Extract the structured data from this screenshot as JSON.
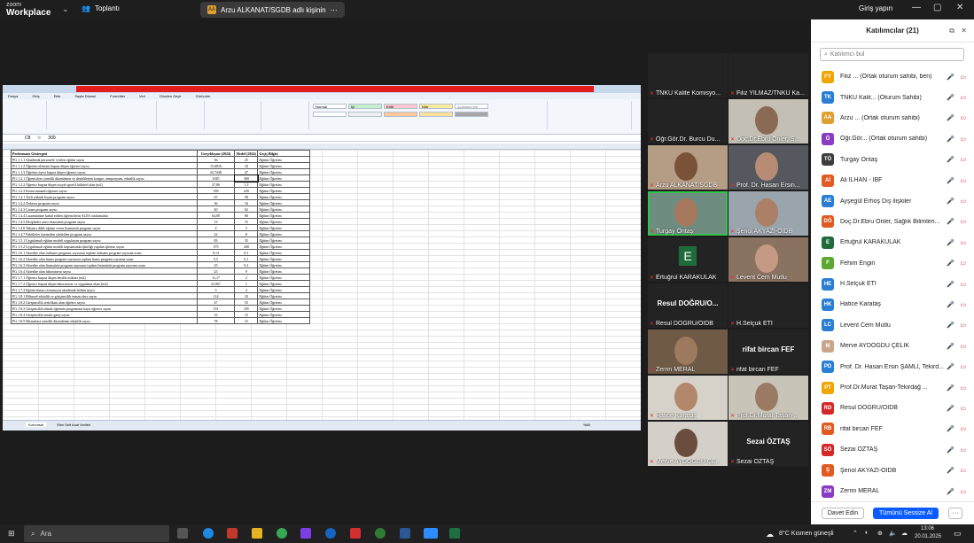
{
  "app": {
    "brand_small": "zoom",
    "brand": "Workplace",
    "meeting": "Toplantı",
    "sharing": "Arzu ALKANAT/SGDB adlı kişinin",
    "signin": "Giriş yapın"
  },
  "excel": {
    "tabs": [
      "Dosya",
      "Giriş",
      "Ekle",
      "Sayfa Düzeni",
      "Formüller",
      "Veri",
      "Gözden Geçir",
      "Görünüm"
    ],
    "styles": [
      "Normal",
      "İyi",
      "Kötü",
      "Nötr",
      "Açıklama Me..."
    ],
    "name_box": "C8",
    "formula": "300",
    "headers": [
      "Performans Göstergesi",
      "Gerçekleşme (2024)",
      "Hedef (2024)",
      "Geçiş Bilgisi"
    ],
    "rows": [
      [
        "PG 1.1.1 Akademik personele verilen eğitim sayısı",
        "36",
        "25",
        "Eğitim Öğretim"
      ],
      [
        "PG 1.1.2 Öğretim elemanı başına düşen öğrenci sayısı",
        "15,6816",
        "18",
        "Eğitim Öğretim"
      ],
      [
        "PG 1.1.3 Öğretim üyesi başına düşen öğrenci sayısı",
        "25,7438",
        "47",
        "Eğitim Öğretim"
      ],
      [
        "PG 1.2.1 Öğrencilere yönelik düzenlenen ve desteklenen kongre, sempozyum, etkinlik sayısı",
        "1045",
        "300",
        "Eğitim Öğretim"
      ],
      [
        "PG 1.2.2 Öğrenci başına düşen sosyal sportif kültürel alan (m2)",
        "27,86",
        "1,3",
        "Eğitim Öğretim"
      ],
      [
        "PG 1.2.3 Kısmi zamanlı öğrenci sayısı",
        "339",
        "220",
        "Eğitim Öğretim"
      ],
      [
        "PG 1.4.1 Tezli yüksek lisans program sayısı",
        "67",
        "58",
        "Eğitim Öğretim"
      ],
      [
        "PG 1.4.2 Doktora program sayısı",
        "36",
        "34",
        "Eğitim Öğretim"
      ],
      [
        "PG 1.4.3 Lisans program sayısı",
        "40",
        "62",
        "Eğitim Öğretim"
      ],
      [
        "PG 1.4.4 Lisansüstüne kabul edilen öğrencilerin ALES ortalamaları",
        "64,08",
        "80",
        "Eğitim Öğretim"
      ],
      [
        "PG 1.4.5 Disiplinler arası lisansüstü program sayısı",
        "13",
        "15",
        "Eğitim Öğretim"
      ],
      [
        "PG 1.4.6 Yabancı dilde eğitim veren lisansüstü program sayısı",
        "4",
        "3",
        "Eğitim Öğretim"
      ],
      [
        "PG 1.4.7 Fakülteler üzerinden yürütülen program sayısı",
        "22",
        "8",
        "Eğitim Öğretim"
      ],
      [
        "PG 1.5.1 Uygulamalı eğitim modeli uygulayan program sayısı",
        "83",
        "35",
        "Eğitim Öğretim"
      ],
      [
        "PG 1.5.2 Uygulamalı eğitim modeli kapsamında işbirliği yapılan işletme sayısı",
        "375",
        "200",
        "Eğitim Öğretim"
      ],
      [
        "PG 1.6.1 Akredite olan önlisans programı sayısının toplam önlisans program sayısına oranı",
        "0,13",
        "0,1",
        "Eğitim Öğretim"
      ],
      [
        "PG 1.6.2 Akredite olan lisans program sayısının toplam lisans program sayısına oranı",
        "5,5",
        "0,1",
        "Eğitim Öğretim"
      ],
      [
        "PG 1.6.3 Akredite olan lisansüstü program sayısının toplam lisansüstü program sayısına oranı",
        "25",
        "0,1",
        "Eğitim Öğretim"
      ],
      [
        "PG 1.6.4 Akredite olan laboratuvar sayısı",
        "25",
        "9",
        "Eğitim Öğretim"
      ],
      [
        "PG 1.7.1 Öğrenci başına düşen derslik miktarı (m2)",
        "11,17",
        "2",
        "Eğitim Öğretim"
      ],
      [
        "PG 1.7.2 Öğrenci başına düşen laboratuvar ve uygulama alanı (m2)",
        "23,067",
        "1",
        "Eğitim Öğretim"
      ],
      [
        "PG 1.7.3 Eğitim binası otomasyon akademik bölüm sayısı",
        "3",
        "4",
        "Eğitim Öğretim"
      ],
      [
        "PG 1.8.1 Bilimsel etkinlik ve girişimcilik teması ders sayısı",
        "114",
        "18",
        "Eğitim Öğretim"
      ],
      [
        "PG 1.8.2 Girişimcilik sertifikası alan öğrenci sayısı",
        "47",
        "55",
        "Eğitim Öğretim"
      ],
      [
        "PG 1.8.3 Girişimcilik teknik öğrenim programına kayıt öğrenci sayısı",
        "191",
        "105",
        "Eğitim Öğretim"
      ],
      [
        "PG 1.8.4 Girişimcilik temalı garaj sayısı",
        "15",
        "15",
        "Eğitim Öğretim"
      ],
      [
        "PG 1.8.5 Mezunlara yönelik düzenlenen etkinlik sayısı",
        "78",
        "15",
        "Eğitim Öğretim"
      ]
    ],
    "sheet_tab": "Kurumsal",
    "sheet_tab2": "Stim Seit Anal Verileri",
    "zoom": "%80"
  },
  "tiles": [
    {
      "name": "TNKÜ Kalite Komisyo...",
      "kind": "blank"
    },
    {
      "name": "Filiz YILMAZ/TNKÜ Ka...",
      "kind": "blank"
    },
    {
      "name": "Öğr.Gör.Dr. Burcu Du...",
      "kind": "blank"
    },
    {
      "name": "Doç.Dr.Ebru Önler, S...",
      "kind": "video",
      "bg": "#c4bfb5",
      "face": "#8a6a52"
    },
    {
      "name": "Arzu ALKANAT/SGDB",
      "kind": "video",
      "bg": "#b59c85",
      "face": "#7a5238"
    },
    {
      "name": "Prof. Dr. Hasan Ersin...",
      "kind": "video",
      "bg": "#55595f",
      "face": "#b88c74"
    },
    {
      "name": "Turgay Öntaş",
      "kind": "video",
      "bg": "#6f8c80",
      "face": "#a6785e",
      "active": true
    },
    {
      "name": "Şenol AKYAZI-OİDB",
      "kind": "video",
      "bg": "#9aa4ad",
      "face": "#ab8066"
    },
    {
      "name": "Ertuğrul KARAKULAK",
      "kind": "letter",
      "letter": "E"
    },
    {
      "name": "Levent Cem Mutlu",
      "kind": "video",
      "bg": "#8a7260",
      "face": "#c59a84"
    },
    {
      "name": "Resul DOĞRU/OİDB",
      "kind": "text",
      "big": "Resul DOĞRU/O..."
    },
    {
      "name": "H.Selçuk ETİ",
      "kind": "blank"
    },
    {
      "name": "Zerrin MERAL",
      "kind": "video",
      "bg": "#6f5a46",
      "face": "#9d7a5d"
    },
    {
      "name": "rifat bircan FEF",
      "kind": "text",
      "big": "rifat bircan FEF"
    },
    {
      "name": "Hatice Karataş",
      "kind": "video",
      "bg": "#d6d2c9",
      "face": "#b2876b"
    },
    {
      "name": "Prof.Dr.Murat Taşan-...",
      "kind": "video",
      "bg": "#c9c4b8",
      "face": "#9b7a64"
    },
    {
      "name": "Merve AYDOĞDU ÇE...",
      "kind": "video",
      "bg": "#d4cfc8",
      "face": "#6b4d3d"
    },
    {
      "name": "Sezai ÖZTAŞ",
      "kind": "text",
      "big": "Sezai ÖZTAŞ"
    }
  ],
  "panel": {
    "title": "Katılımcılar (21)",
    "search": "Katılımcı bul",
    "participants": [
      {
        "i": "FY",
        "name": "Filiz ... (Ortak oturum sahibi, ben)",
        "c": "#f0a500",
        "host": false
      },
      {
        "i": "TK",
        "name": "TNKÜ Kalit... (Oturum Sahibi)",
        "c": "#2a7fd4"
      },
      {
        "i": "AA",
        "name": "Arzu ... (Ortak oturum sahibi)",
        "c": "#e0a030"
      },
      {
        "i": "Ö",
        "name": "Öğr.Gör... (Ortak oturum sahibi)",
        "c": "#8a3cc4"
      },
      {
        "i": "TÖ",
        "name": "Turgay Öntaş",
        "c": "#3d3d3d"
      },
      {
        "i": "Aİ",
        "name": "Ali İLHAN - İBF",
        "c": "#e05a22"
      },
      {
        "i": "AE",
        "name": "Ayşegül Erhoş Dış ilişkiler",
        "c": "#2a7fd4"
      },
      {
        "i": "DÖ",
        "name": "Doç.Dr.Ebru Önler, Sağlık Bilimleri...",
        "c": "#e05a22"
      },
      {
        "i": "E",
        "name": "Ertuğrul KARAKULAK",
        "c": "#1f6b3a"
      },
      {
        "i": "F",
        "name": "Fehim Engin",
        "c": "#5aa830"
      },
      {
        "i": "HE",
        "name": "H.Selçuk ETİ",
        "c": "#2a7fd4"
      },
      {
        "i": "HK",
        "name": "Hatice Karataş",
        "c": "#2a7fd4"
      },
      {
        "i": "LC",
        "name": "Levent Cem Mutlu",
        "c": "#2a7fd4"
      },
      {
        "i": "M",
        "name": "Merve AYDOĞDU ÇELİK",
        "c": "#c9a58a"
      },
      {
        "i": "PD",
        "name": "Prof. Dr. Hasan Ersin ŞAMLI, Tekird...",
        "c": "#2a7fd4"
      },
      {
        "i": "PT",
        "name": "Prof.Dr.Murat Taşan-Tekirdağ ...",
        "c": "#f0a500"
      },
      {
        "i": "RD",
        "name": "Resul DOĞRU/OİDB",
        "c": "#d62828"
      },
      {
        "i": "RB",
        "name": "rifat bircan FEF",
        "c": "#e05a22"
      },
      {
        "i": "SÖ",
        "name": "Sezai ÖZTAŞ",
        "c": "#d62828"
      },
      {
        "i": "Ş",
        "name": "Şenol AKYAZI-OİDB",
        "c": "#e05a22"
      },
      {
        "i": "ZM",
        "name": "Zerrin MERAL",
        "c": "#8a3cc4"
      }
    ],
    "invite": "Davet Edin",
    "mute_all": "Tümünü Sessize Al",
    "more": "···"
  },
  "taskbar": {
    "search": "Ara",
    "weather": "8°C  Kısmen güneşli",
    "time": "13:06",
    "date": "20.01.2025"
  }
}
